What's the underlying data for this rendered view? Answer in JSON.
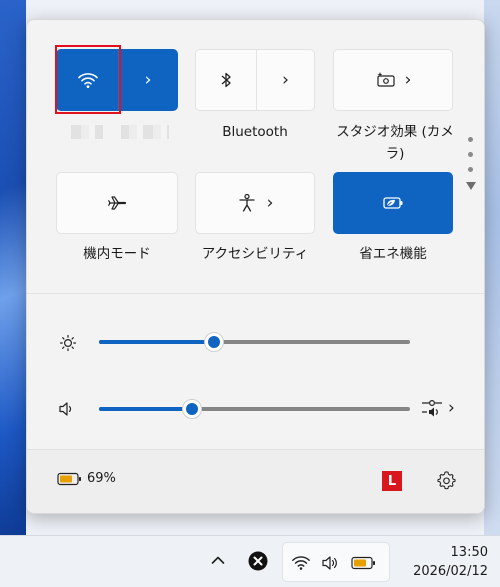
{
  "panel": {
    "tiles": {
      "wifi": {
        "icon": "wifi-icon",
        "expand": "chevron-right-icon",
        "state": "on",
        "network_name_label": ""
      },
      "bluetooth": {
        "label": "Bluetooth",
        "icon": "bluetooth-icon",
        "expand": "chevron-right-icon"
      },
      "studio_effects": {
        "label_line1": "スタジオ効果 (カメ",
        "label_line2": "ラ)",
        "icon": "camera-effects-icon",
        "expand": "chevron-right-icon"
      },
      "airplane": {
        "label": "機内モード",
        "icon": "airplane-icon"
      },
      "accessibility": {
        "label": "アクセシビリティ",
        "icon": "accessibility-icon",
        "expand": "chevron-right-icon"
      },
      "energy_saver": {
        "label": "省エネ機能",
        "icon": "battery-leaf-icon",
        "state": "on"
      }
    },
    "pagination": {
      "pages": 2,
      "current": 1
    },
    "brightness": {
      "icon": "sun-icon",
      "level": 0.37
    },
    "volume": {
      "icon": "speaker-icon",
      "level": 0.3,
      "output_icon": "audio-output-icon",
      "expand": "chevron-right-icon"
    },
    "footer": {
      "battery_percent": "69%",
      "battery_icon": "battery-icon",
      "app_badge": "L",
      "settings_icon": "gear-icon"
    }
  },
  "taskbar": {
    "overflow_icon": "chevron-up-icon",
    "app_icon": "close-circle-icon",
    "tray": [
      "wifi-icon",
      "speaker-icon",
      "battery-icon"
    ],
    "time": "13:50",
    "date": "2026/02/12"
  },
  "colors": {
    "accent": "#0f64c2",
    "highlight_box": "#e0101e",
    "badge": "#d7161e",
    "battery_fill": "#e6a100"
  }
}
